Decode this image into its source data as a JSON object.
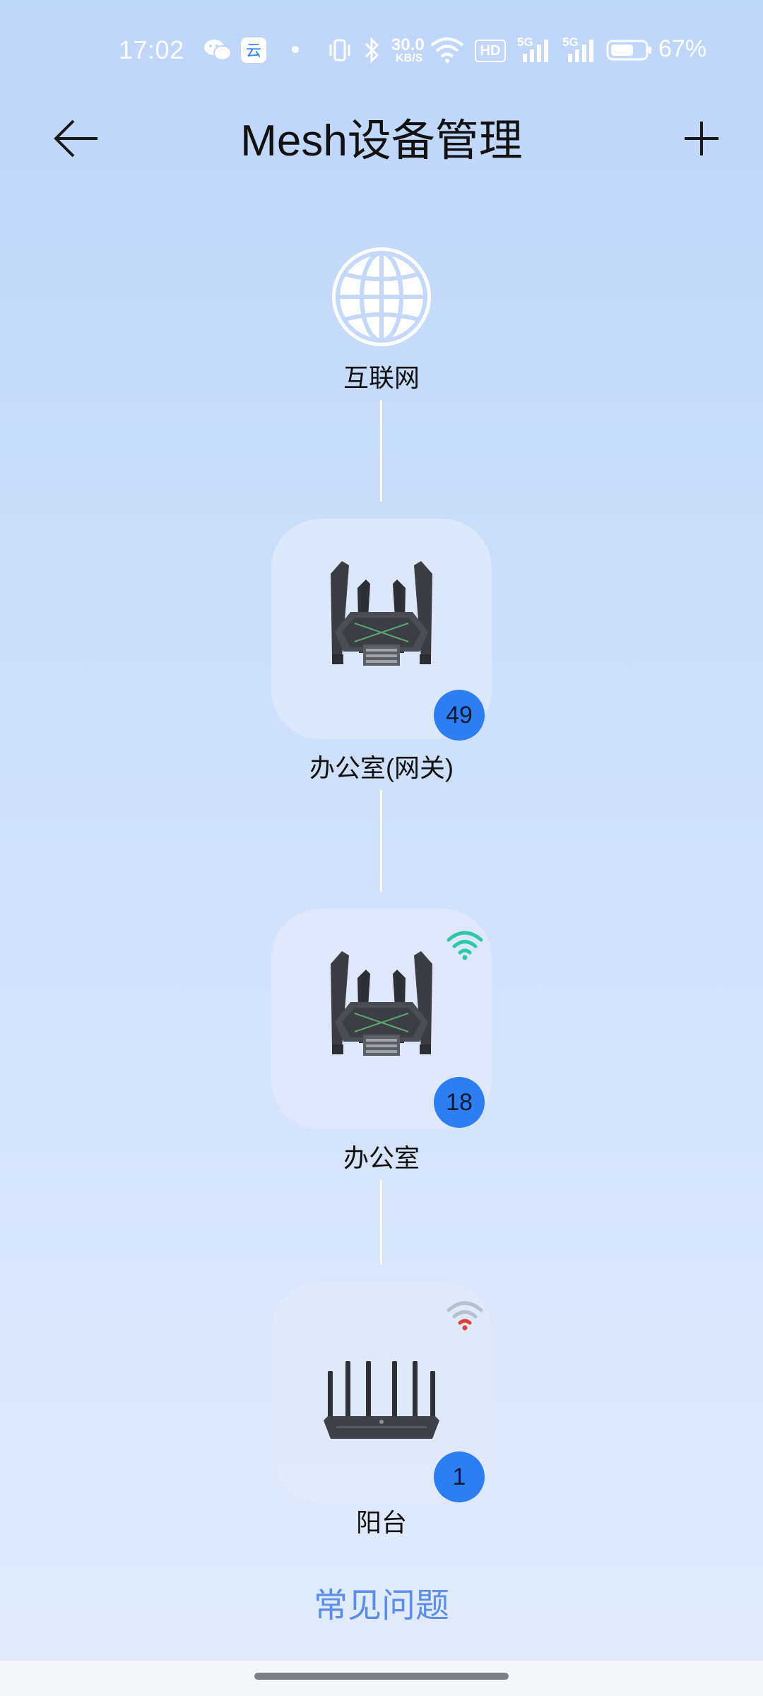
{
  "status_bar": {
    "time": "17:02",
    "network_speed_value": "30.0",
    "network_speed_unit": "KB/S",
    "hd_label": "HD",
    "signal1_label": "5G",
    "signal2_label": "5G",
    "battery_percent": "67%",
    "battery_level": 0.67,
    "icons": [
      "wechat-icon",
      "app-notification-icon",
      "dot-icon",
      "vibrate-icon",
      "bluetooth-icon",
      "wifi-icon",
      "hd-icon",
      "signal-icon",
      "signal-icon",
      "battery-icon"
    ]
  },
  "header": {
    "title": "Mesh设备管理",
    "back_icon": "arrow-left-icon",
    "add_icon": "plus-icon"
  },
  "topology": {
    "internet": {
      "icon": "globe-icon",
      "label": "互联网"
    },
    "nodes": [
      {
        "label": "办公室(网关)",
        "count": "49",
        "device_icon": "router-tri-band-icon",
        "wifi_status": "none"
      },
      {
        "label": "办公室",
        "count": "18",
        "device_icon": "router-tri-band-icon",
        "wifi_status": "strong",
        "wifi_color": "#2ec9a5"
      },
      {
        "label": "阳台",
        "count": "1",
        "device_icon": "router-flat-icon",
        "wifi_status": "weak",
        "wifi_color": "#e0413b"
      }
    ]
  },
  "footer": {
    "faq_label": "常见问题"
  },
  "colors": {
    "badge": "#2e7ef3",
    "faq_link": "#5b8ee8",
    "wifi_strong": "#2ec9a5",
    "wifi_weak": "#e0413b"
  }
}
